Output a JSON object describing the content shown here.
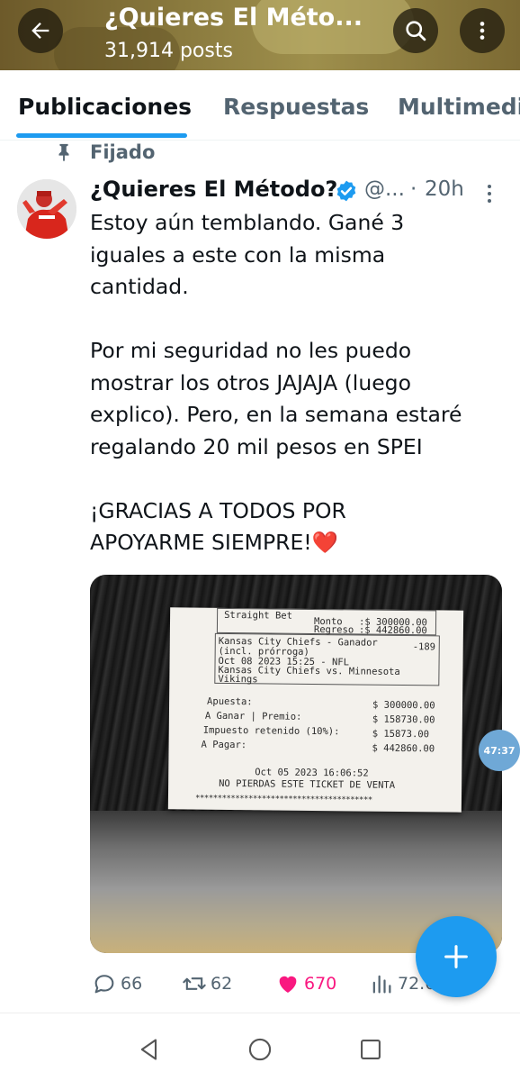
{
  "header": {
    "title": "¿Quieres El Méto...",
    "posts_count": "31,914 posts",
    "back_icon": "arrow-left-icon",
    "search_icon": "search-icon",
    "more_icon": "more-vertical-icon"
  },
  "tabs": [
    {
      "label": "Publicaciones",
      "active": true
    },
    {
      "label": "Respuestas",
      "active": false
    },
    {
      "label": "Multimedi",
      "active": false
    }
  ],
  "pinned_label": "Fijado",
  "tweet": {
    "display_name": "¿Quieres El Método?",
    "handle": "@...",
    "separator": "·",
    "time": "20h",
    "lines": [
      "Estoy aún temblando. Gané 3",
      "iguales a este con la misma",
      "cantidad.",
      "",
      "Por mi seguridad no les puedo",
      "mostrar los otros JAJAJA (luego",
      "explico). Pero, en la semana estaré",
      "regalando 20 mil pesos en SPEI",
      "",
      "¡GRACIAS A TODOS POR",
      "APOYARME SIEMPRE!❤️"
    ]
  },
  "receipt": {
    "bet_type": "Straight Bet",
    "monto_label": "Monto",
    "monto_value": ":$ 300000.00",
    "regreso_label": "Regreso",
    "regreso_value": ":$ 442860.00",
    "pick": "Kansas City Chiefs - Ganador",
    "odds": "-189",
    "pick_note": "(incl. prórroga)",
    "event_date": "Oct 08 2023 15:25 - NFL",
    "matchup": "Kansas City Chiefs vs. Minnesota",
    "matchup_2": "Vikings",
    "apuesta_label": "Apuesta:",
    "apuesta_value": "$ 300000.00",
    "ganar_label": "A Ganar | Premio:",
    "ganar_value": "$ 158730.00",
    "impuesto_label": "Impuesto retenido (10%):",
    "impuesto_value": "$  15873.00",
    "pagar_label": "A Pagar:",
    "pagar_value": "$ 442860.00",
    "printed_at": "Oct 05 2023 16:06:52",
    "footer": "NO PIERDAS ESTE TICKET DE VENTA",
    "stars": "****************************************"
  },
  "timer_badge": "47:37",
  "actions": {
    "replies": "66",
    "retweets": "62",
    "likes": "670",
    "views": "72.6"
  },
  "colors": {
    "accent": "#1d9bf0",
    "like": "#f91880",
    "muted": "#536471"
  }
}
